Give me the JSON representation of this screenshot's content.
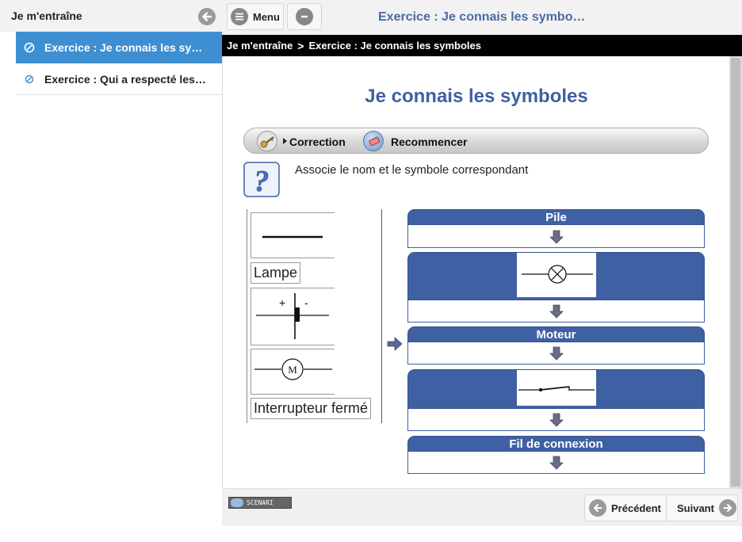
{
  "outline": {
    "title": "Je m'entraîne",
    "items": [
      {
        "label": "Exercice : Je connais les symboles",
        "active": true
      },
      {
        "label": "Exercice : Qui a respecté les consignes",
        "active": false
      }
    ]
  },
  "topbar": {
    "menu_label": "Menu",
    "window_title": "Exercice : Je connais les symbo…"
  },
  "breadcrumb": [
    "Je m'entraîne",
    "Exercice : Je connais les symboles"
  ],
  "content": {
    "title": "Je connais les symboles",
    "toolbar": {
      "correction_label": "Correction",
      "restart_label": "Recommencer"
    },
    "instruction": "Associe le nom et le symbole correspondant",
    "source_items": [
      "Lampe",
      "Interrupteur fermé"
    ],
    "symbol_texts": {
      "battery_plus": "+",
      "battery_minus": "-",
      "motor": "M"
    },
    "targets": [
      "Pile",
      "Moteur",
      "Fil de connexion"
    ]
  },
  "footer": {
    "logo_text": "SCENARI",
    "prev_label": "Précédent",
    "next_label": "Suivant"
  },
  "colors": {
    "accent": "#3f61a3",
    "active_item": "#3e8fd2",
    "breadcrumb_bg": "#000000"
  }
}
